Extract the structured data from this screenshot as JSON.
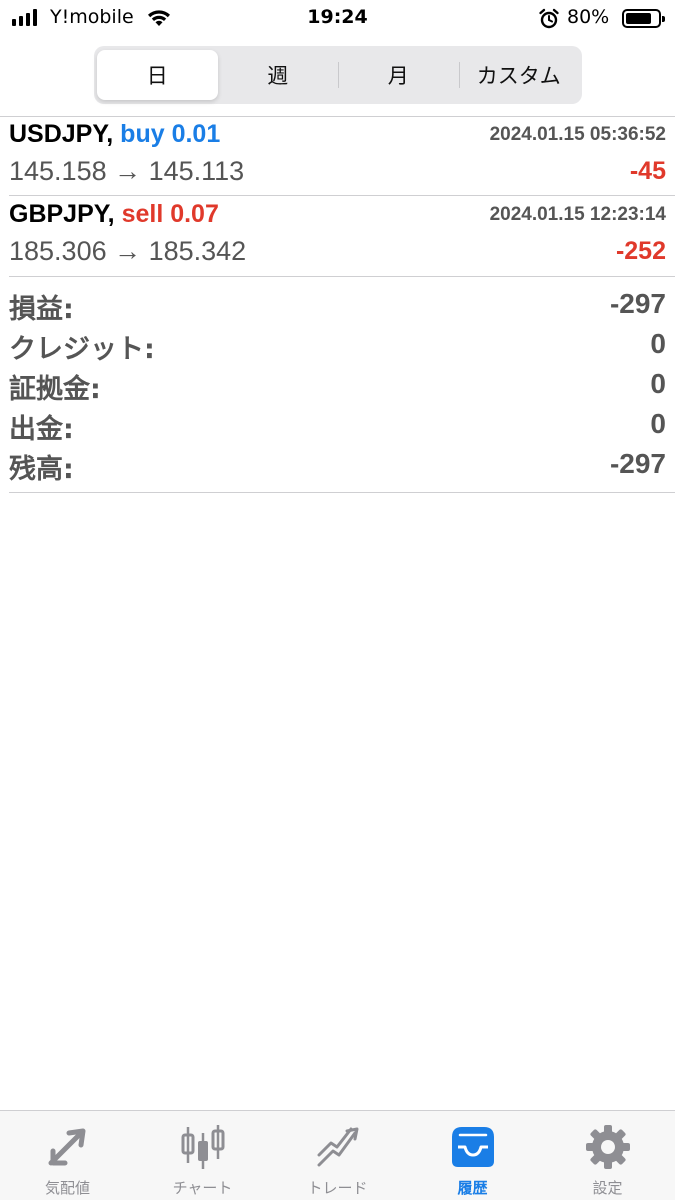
{
  "status_bar": {
    "carrier": "Y!mobile",
    "time": "19:24",
    "battery": "80%",
    "battery_level": 0.8
  },
  "period_tabs": {
    "items": [
      "日",
      "週",
      "月",
      "カスタム"
    ],
    "selected": "日"
  },
  "trades": [
    {
      "symbol": "USDJPY,",
      "side": "buy",
      "lot": "buy 0.01",
      "datetime": "2024.01.15 05:36:52",
      "prices": "145.158 → 145.113",
      "profit": "-45"
    },
    {
      "symbol": "GBPJPY,",
      "side": "sell",
      "lot": "sell 0.07",
      "datetime": "2024.01.15 12:23:14",
      "prices": "185.306 → 185.342",
      "profit": "-252"
    }
  ],
  "summary": {
    "profit_label": "損益:",
    "profit_value": "-297",
    "credit_label": "クレジット:",
    "credit_value": "0",
    "deposit_label": "証拠金:",
    "deposit_value": "0",
    "withdrawal_label": "出金:",
    "withdrawal_value": "0",
    "balance_label": "残高:",
    "balance_value": "-297"
  },
  "tab_bar": {
    "items": [
      {
        "label": "気配値",
        "icon": "quotes-arrows-icon"
      },
      {
        "label": "チャート",
        "icon": "candlestick-chart-icon"
      },
      {
        "label": "トレード",
        "icon": "trade-trend-icon"
      },
      {
        "label": "履歴",
        "icon": "history-inbox-icon"
      },
      {
        "label": "設定",
        "icon": "settings-gear-icon"
      }
    ],
    "active": "履歴"
  },
  "colors": {
    "accent_blue": "#1a7ee6",
    "loss_red": "#e0392b",
    "text_gray": "#555555",
    "inactive_gray": "#8e8e93"
  }
}
